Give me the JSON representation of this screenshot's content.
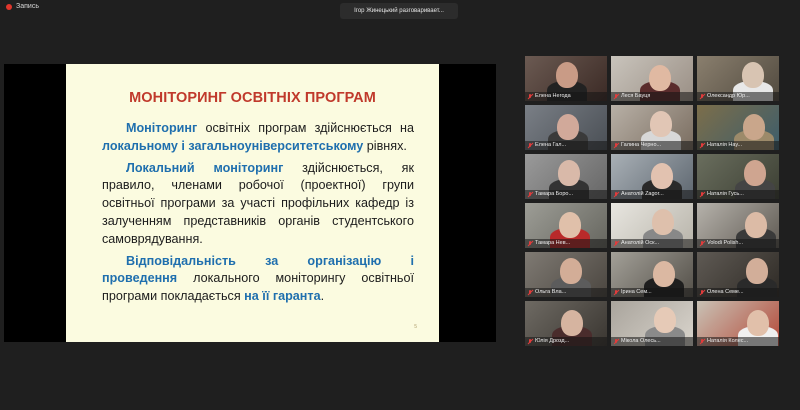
{
  "recording": {
    "label": "Запись",
    "color": "#e0362c"
  },
  "active_speaker": {
    "text": "Ігор Жинецький разговаривает..."
  },
  "slide": {
    "title": "МОНІТОРИНГ ОСВІТНІХ ПРОГРАМ",
    "p1": {
      "a": "Моніторинг",
      "b": " освітніх програм здійснюється на ",
      "c": "локальному і загальноуніверситетському",
      "d": " рівнях."
    },
    "p2": {
      "a": "Локальний моніторинг",
      "b": " здійснюється, як правило, членами робочої (проектної) групи освітньої програми за участі профільних кафедр із залученням представників органів студентського самоврядування."
    },
    "p3": {
      "a": "Відповідальність за організацію і проведення",
      "b": " локального моніторингу освітньої програми покладається ",
      "c": "на її гаранта",
      "d": "."
    },
    "page_number": "5",
    "title_color": "#c0392b",
    "highlight_color": "#1f6fae"
  },
  "participants": [
    {
      "name": "Елена Негода",
      "muted": true,
      "icon": "mic-off-icon"
    },
    {
      "name": "Леся Бауця",
      "muted": true,
      "icon": "mic-off-icon"
    },
    {
      "name": "Олександр Юр...",
      "muted": true,
      "icon": "mic-off-icon"
    },
    {
      "name": "Елена Гал...",
      "muted": true,
      "icon": "mic-off-icon"
    },
    {
      "name": "Галина Черно...",
      "muted": true,
      "icon": "mic-off-icon"
    },
    {
      "name": "Наталія Нау...",
      "muted": true,
      "icon": "mic-off-icon"
    },
    {
      "name": "Тамара Боро...",
      "muted": true,
      "icon": "mic-off-icon"
    },
    {
      "name": "Анатолій Zagor...",
      "muted": true,
      "icon": "mic-off-icon"
    },
    {
      "name": "Наталія Гусь...",
      "muted": true,
      "icon": "mic-off-icon"
    },
    {
      "name": "Тамара Нев...",
      "muted": true,
      "icon": "mic-off-icon"
    },
    {
      "name": "Анатолій Оск...",
      "muted": true,
      "icon": "mic-off-icon"
    },
    {
      "name": "Volodi Polish...",
      "muted": true,
      "icon": "mic-off-icon"
    },
    {
      "name": "Ольга Вла...",
      "muted": true,
      "icon": "mic-off-icon"
    },
    {
      "name": "Ірина Сем...",
      "muted": true,
      "icon": "mic-off-icon"
    },
    {
      "name": "Олена Семе...",
      "muted": true,
      "icon": "mic-off-icon"
    },
    {
      "name": "Юлія Дрозд...",
      "muted": true,
      "icon": "mic-off-icon"
    },
    {
      "name": "Мікола Олесь...",
      "muted": true,
      "icon": "mic-off-icon"
    },
    {
      "name": "Наталія Колес...",
      "muted": true,
      "icon": "mic-off-icon"
    }
  ]
}
